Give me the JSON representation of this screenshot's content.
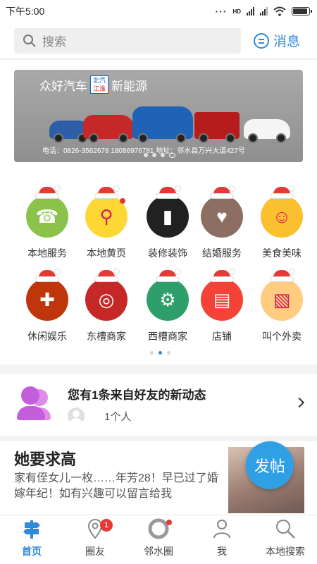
{
  "status_bar": {
    "time": "下午5:00",
    "network": "HD"
  },
  "header": {
    "search_placeholder": "搜索",
    "message_label": "消息"
  },
  "banner": {
    "title_left": "众好汽车",
    "brand_line1": "北汽",
    "brand_line2": "江淮",
    "title_right": "新能源",
    "contact": "电话：0826-3562678  18086976781  地址：邻水县万兴大道427号"
  },
  "categories": [
    {
      "label": "本地服务",
      "icon": "phone-icon",
      "color": "#8bc34a"
    },
    {
      "label": "本地黄页",
      "icon": "magnifier-icon",
      "color": "#fdd835"
    },
    {
      "label": "装修装饰",
      "icon": "paint-roller-icon",
      "color": "#212121"
    },
    {
      "label": "结婚服务",
      "icon": "wedding-couple-icon",
      "color": "#8d6e63"
    },
    {
      "label": "美食美味",
      "icon": "face-icon",
      "color": "#fbc02d"
    },
    {
      "label": "休闲娱乐",
      "icon": "game-controller-icon",
      "color": "#bf360c"
    },
    {
      "label": "东槽商家",
      "icon": "ring-icon",
      "color": "#c62828"
    },
    {
      "label": "西槽商家",
      "icon": "gear-icon",
      "color": "#2e9e6a"
    },
    {
      "label": "店铺",
      "icon": "storefront-icon",
      "color": "#f44336"
    },
    {
      "label": "叫个外卖",
      "icon": "takeout-icon",
      "color": "#ffcc80"
    }
  ],
  "friend_update": {
    "title": "您有1条来自好友的新动态",
    "count_text": "1个人"
  },
  "post": {
    "title": "她要求高",
    "body": "家有侄女儿一枚……年芳28！早已过了婚嫁年纪！如有兴趣可以留言给我"
  },
  "fab_label": "发帖",
  "tabs": [
    {
      "label": "首页",
      "icon": "signpost-icon",
      "active": true
    },
    {
      "label": "圈友",
      "icon": "location-pin-icon",
      "badge": "1"
    },
    {
      "label": "邻水圈",
      "icon": "circle-icon",
      "dot": true
    },
    {
      "label": "我",
      "icon": "person-icon"
    },
    {
      "label": "本地搜索",
      "icon": "search-icon"
    }
  ],
  "colors": {
    "accent": "#2f8ad8",
    "badge": "#e53935",
    "fab": "#2f9fe6"
  }
}
